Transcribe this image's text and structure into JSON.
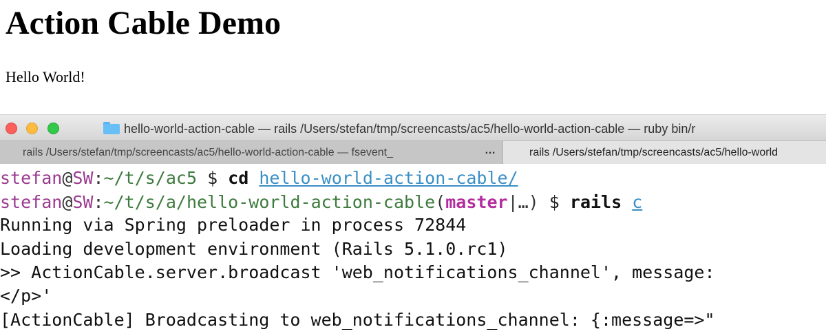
{
  "page": {
    "title": "Action Cable Demo",
    "body_text": "Hello World!"
  },
  "terminal": {
    "window_title": "hello-world-action-cable — rails  /Users/stefan/tmp/screencasts/ac5/hello-world-action-cable — ruby bin/r",
    "tabs": [
      {
        "label": "rails  /Users/stefan/tmp/screencasts/ac5/hello-world-action-cable — fsevent_",
        "active": false
      },
      {
        "label": "rails  /Users/stefan/tmp/screencasts/ac5/hello-world",
        "active": true
      }
    ],
    "tab_overflow": "…",
    "lines": {
      "l1": {
        "user": "stefan",
        "at": "@",
        "host": "SW",
        "colon": ":",
        "path": "~/t/s/ac5",
        "dollar": " $ ",
        "command": "cd",
        "arg": "hello-world-action-cable/"
      },
      "l2": {
        "user": "stefan",
        "at": "@",
        "host": "SW",
        "colon": ":",
        "path": "~/t/s/a/hello-world-action-cable",
        "paren_open": "(",
        "branch": "master",
        "branch_suffix": "|…) ",
        "dollar": "$ ",
        "command": "rails",
        "arg": "c"
      },
      "l3": "Running via Spring preloader in process 72844",
      "l4": "Loading development environment (Rails 5.1.0.rc1)",
      "l5": ">> ActionCable.server.broadcast 'web_notifications_channel', message:",
      "l6": "</p>'",
      "l7": "[ActionCable] Broadcasting to web_notifications_channel: {:message=>\""
    }
  },
  "colors": {
    "close": "#fc605c",
    "minimize": "#fdbc40",
    "zoom": "#34c84a",
    "prompt_user": "#9b3a8f",
    "prompt_path": "#3d7a3d",
    "branch": "#b32d9f",
    "link": "#3a8fc6"
  }
}
